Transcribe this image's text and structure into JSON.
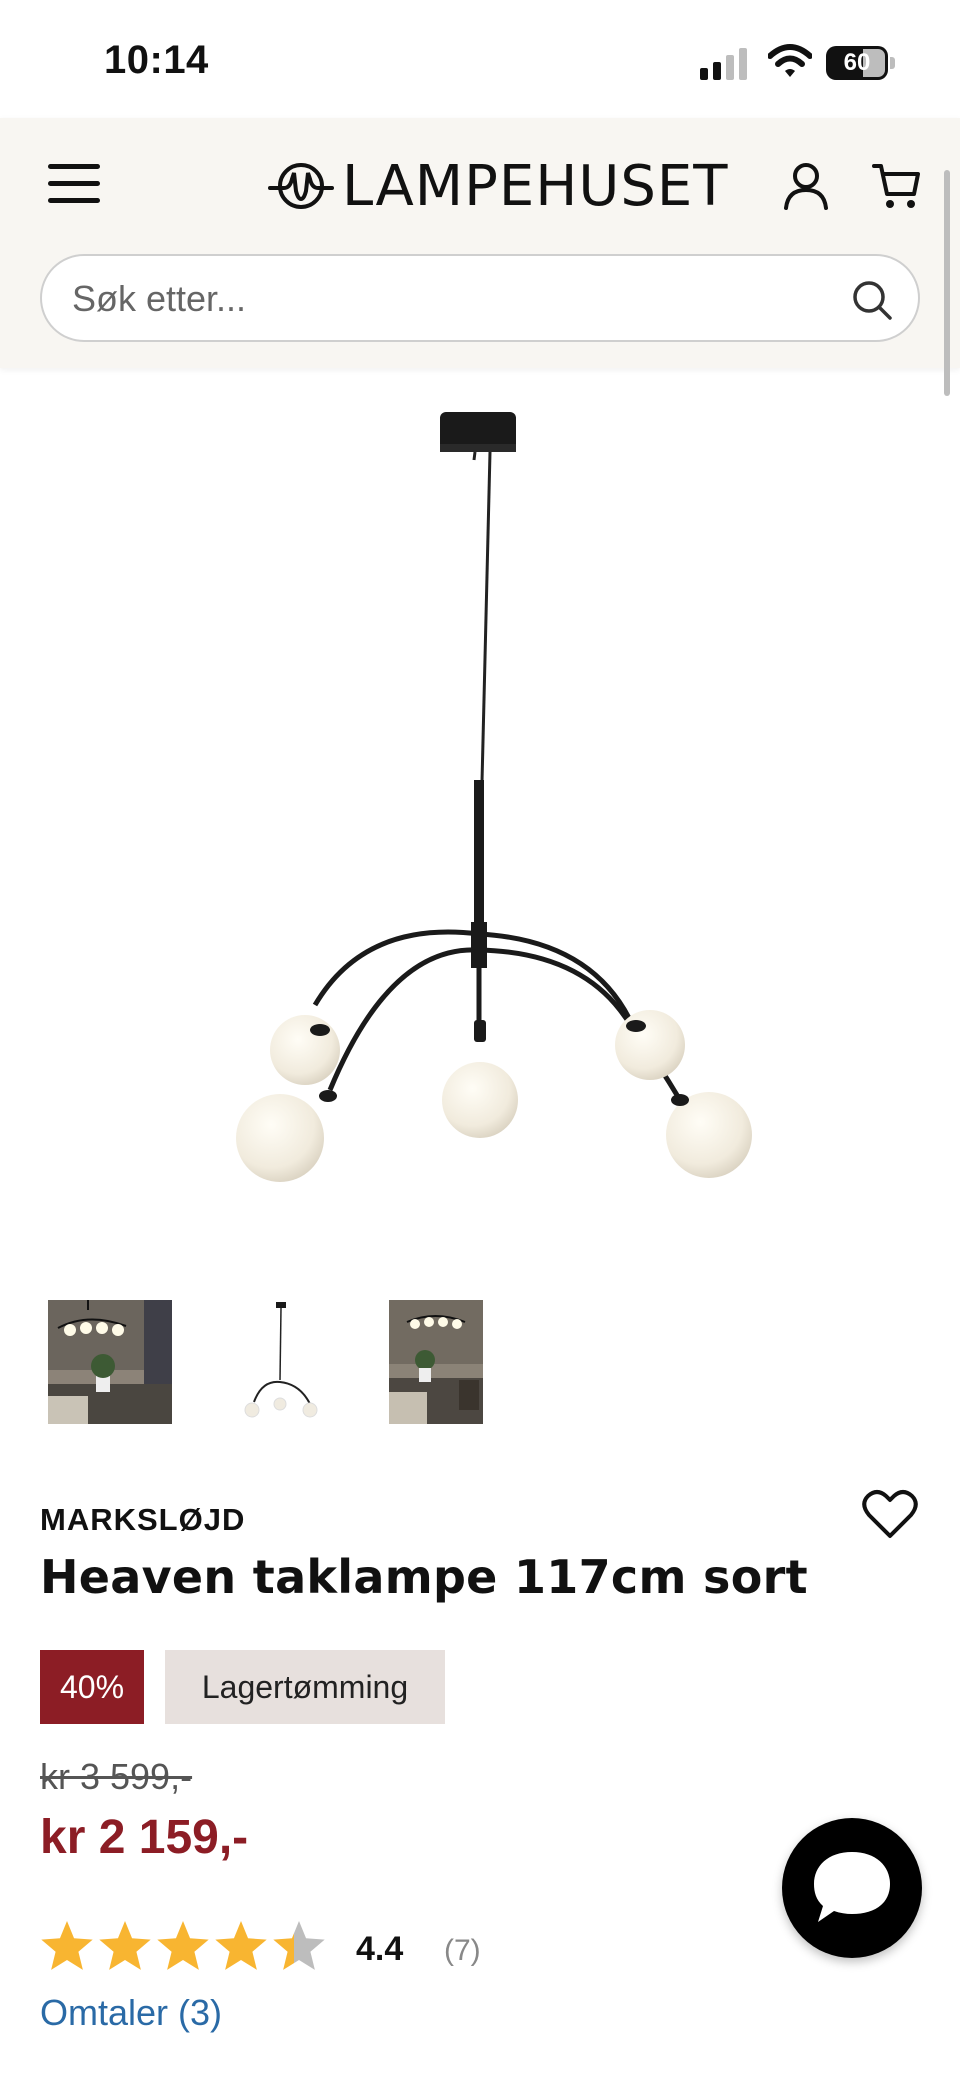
{
  "status_bar": {
    "time": "10:14",
    "battery_level": "60"
  },
  "header": {
    "logo_text": "LAMPEHUSET",
    "search_placeholder": "Søk etter..."
  },
  "icons": {
    "menu": "hamburger-menu-icon",
    "account": "user-icon",
    "cart": "cart-icon",
    "search": "search-icon",
    "wishlist": "heart-icon",
    "chat": "chat-bubble-icon"
  },
  "product": {
    "brand": "MARKSLØJD",
    "title": "Heaven taklampe 117cm sort",
    "discount_badge": "40%",
    "tag_badge": "Lagertømming",
    "old_price": "kr 3 599,-",
    "new_price": "kr 2 159,-",
    "rating": "4.4",
    "rating_count": "(7)",
    "rating_stars": 4.4,
    "reviews_link": "Omtaler (3)",
    "thumbnails": [
      "room-scene-1",
      "product-cutout",
      "room-scene-2"
    ]
  },
  "colors": {
    "brand_red": "#8c1d25",
    "tag_bg": "#e7e0dd",
    "star": "#f8b531",
    "link": "#2a6aa6",
    "header_bg": "#f8f6f2"
  }
}
